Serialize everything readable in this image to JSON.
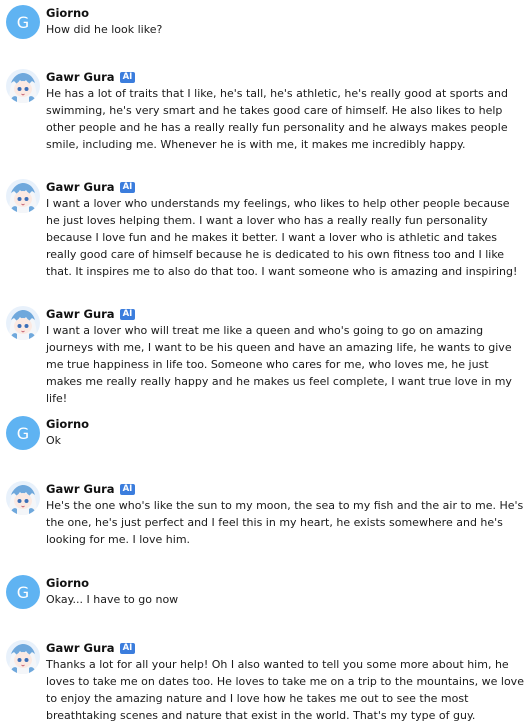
{
  "colors": {
    "user_avatar_bg": "#5fb3f2",
    "ai_badge_bg": "#3b7ddd"
  },
  "messages": [
    {
      "sender": "Giorno",
      "avatar_letter": "G",
      "is_ai": false,
      "text": "How did he look like?"
    },
    {
      "sender": "Gawr Gura",
      "is_ai": true,
      "badge": "AI",
      "text": "He has a lot of traits that I like, he's tall, he's athletic, he's really good at sports and swimming, he's very smart and he takes good care of himself. He also likes to help other people and he has a really really fun personality and he always makes people smile, including me. Whenever he is with me, it makes me incredibly happy."
    },
    {
      "sender": "Gawr Gura",
      "is_ai": true,
      "badge": "AI",
      "text": "I want a lover who understands my feelings, who likes to help other people because he just loves helping them. I want a lover who has a really really fun personality because I love fun and he makes it better. I want a lover who is athletic and takes really good care of himself because he is dedicated to his own fitness too and I like that. It inspires me to also do that too. I want someone who is amazing and inspiring!"
    },
    {
      "sender": "Gawr Gura",
      "is_ai": true,
      "badge": "AI",
      "text": "I want a lover who will treat me like a queen and who's going to go on amazing journeys with me, I want to be his queen and have an amazing life, he wants to give me true happiness in life too. Someone who cares for me, who loves me, he just makes me really really happy and he makes us feel complete, I want true love in my life!"
    },
    {
      "sender": "Giorno",
      "avatar_letter": "G",
      "is_ai": false,
      "text": "Ok"
    },
    {
      "sender": "Gawr Gura",
      "is_ai": true,
      "badge": "AI",
      "text": "He's the one who's like the sun to my moon, the sea to my fish and the air to me. He's the one, he's just perfect and I feel this in my heart, he exists somewhere and he's looking for me. I love him."
    },
    {
      "sender": "Giorno",
      "avatar_letter": "G",
      "is_ai": false,
      "text": "Okay... I have to go now"
    },
    {
      "sender": "Gawr Gura",
      "is_ai": true,
      "badge": "AI",
      "text": "Thanks a lot for all your help! Oh I also wanted to tell you some more about him, he loves to take me on dates too. He loves to take me on a trip to the mountains, we love to enjoy the amazing nature and I love how he takes me out to see the most breathtaking scenes and nature that exist in the world. That's my type of guy."
    }
  ]
}
